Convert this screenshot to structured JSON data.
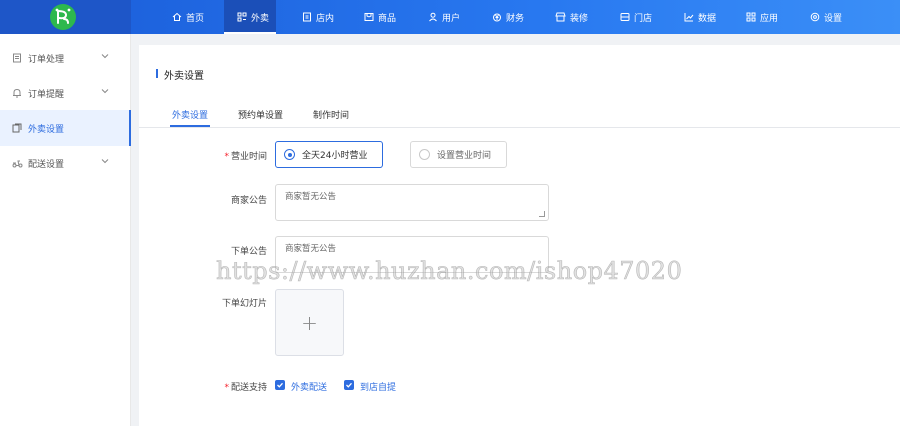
{
  "nav": {
    "items": [
      {
        "label": "首页",
        "icon": "home-icon"
      },
      {
        "label": "外卖",
        "icon": "takeout-icon"
      },
      {
        "label": "店内",
        "icon": "store-inside-icon"
      },
      {
        "label": "商品",
        "icon": "goods-icon"
      },
      {
        "label": "用户",
        "icon": "user-icon"
      },
      {
        "label": "财务",
        "icon": "finance-icon"
      },
      {
        "label": "装修",
        "icon": "decoration-icon"
      },
      {
        "label": "门店",
        "icon": "shop-icon"
      },
      {
        "label": "数据",
        "icon": "data-chart-icon"
      },
      {
        "label": "应用",
        "icon": "apps-grid-icon"
      },
      {
        "label": "设置",
        "icon": "gear-icon"
      }
    ],
    "active_index": 1,
    "colors": {
      "bar": "#2878f0",
      "logo_bg": "#2db84d"
    }
  },
  "sidebar": {
    "items": [
      {
        "label": "订单处理",
        "icon": "order-doc-icon",
        "has_chevron": true
      },
      {
        "label": "订单提醒",
        "icon": "bell-icon",
        "has_chevron": true
      },
      {
        "label": "外卖设置",
        "icon": "settings-doc-icon",
        "has_chevron": false
      },
      {
        "label": "配送设置",
        "icon": "delivery-icon",
        "has_chevron": true
      }
    ],
    "active_index": 2
  },
  "page": {
    "title": "外卖设置",
    "tabs": [
      "外卖设置",
      "预约单设置",
      "制作时间"
    ],
    "active_tab": 0
  },
  "form": {
    "business_hours": {
      "label": "营业时间",
      "required": true,
      "options": [
        "全天24小时营业",
        "设置营业时间"
      ],
      "selected": 0
    },
    "merchant_notice": {
      "label": "商家公告",
      "value": "商家暂无公告"
    },
    "order_notice": {
      "label": "下单公告",
      "value": "商家暂无公告"
    },
    "order_slides": {
      "label": "下单幻灯片",
      "upload_symbol": "+"
    },
    "delivery_support": {
      "label": "配送支持",
      "required": true,
      "options": [
        {
          "label": "外卖配送",
          "checked": true
        },
        {
          "label": "到店自提",
          "checked": true
        }
      ]
    }
  },
  "watermark": "https://www.huzhan.com/ishop47020",
  "accent_color": "#2d6cdf"
}
